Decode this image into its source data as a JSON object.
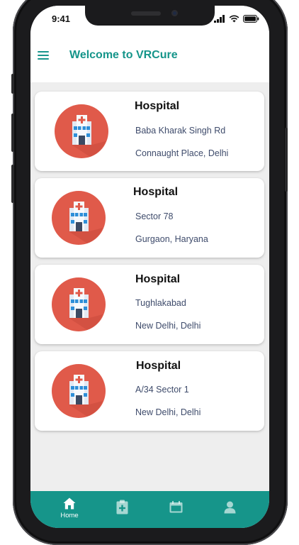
{
  "status_bar": {
    "time": "9:41"
  },
  "app_bar": {
    "title": "Welcome to VRCure",
    "menu_icon": "hamburger-menu-icon"
  },
  "hospitals": [
    {
      "title": "Hospital",
      "line1": "Baba Kharak Singh Rd",
      "line2": "Connaught Place, Delhi",
      "icon": "hospital-building-icon"
    },
    {
      "title": "Hospital",
      "line1": "Sector 78",
      "line2": "Gurgaon, Haryana",
      "icon": "hospital-building-icon"
    },
    {
      "title": "Hospital",
      "line1": "Tughlakabad",
      "line2": "New Delhi, Delhi",
      "icon": "hospital-building-icon"
    },
    {
      "title": "Hospital",
      "line1": "A/34 Sector 1",
      "line2": "New Delhi, Delhi",
      "icon": "hospital-building-icon"
    }
  ],
  "bottom_nav": {
    "items": [
      {
        "label": "Home",
        "icon": "home-icon",
        "active": true
      },
      {
        "label": "",
        "icon": "medical-clipboard-icon",
        "active": false
      },
      {
        "label": "",
        "icon": "calendar-icon",
        "active": false
      },
      {
        "label": "",
        "icon": "profile-icon",
        "active": false
      }
    ]
  },
  "colors": {
    "accent": "#16958a",
    "icon_circle": "#e05a4a",
    "background": "#eeeeee",
    "address_text": "#3e4b6b"
  }
}
